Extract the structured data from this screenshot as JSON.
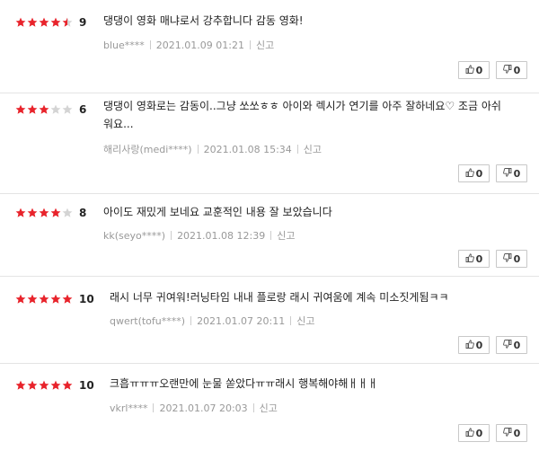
{
  "reviews": [
    {
      "stars": 4.5,
      "score": "9",
      "text": "댕댕이 영화 매냐로서 강추합니다 감동 영화!",
      "author": "blue****",
      "date": "2021.01.09 01:21",
      "report": "신고",
      "likes": "0",
      "dislikes": "0"
    },
    {
      "stars": 3,
      "score": "6",
      "text": "댕댕이 영화로는 감동이..그냥 쏘쏘ㅎㅎ 아이와 렉시가 연기를 아주 잘하네요♡ 조금 아쉬워요...",
      "author": "해리사랑(medi****)",
      "date": "2021.01.08 15:34",
      "report": "신고",
      "likes": "0",
      "dislikes": "0"
    },
    {
      "stars": 4,
      "score": "8",
      "text": "아이도 재밌게 보네요 교훈적인 내용 잘 보았습니다",
      "author": "kk(seyo****)",
      "date": "2021.01.08 12:39",
      "report": "신고",
      "likes": "0",
      "dislikes": "0"
    },
    {
      "stars": 5,
      "score": "10",
      "text": "래시 너무 귀여워!러닝타임 내내 플로랑 래시 귀여움에 계속 미소짓게됨ㅋㅋ",
      "author": "qwert(tofu****)",
      "date": "2021.01.07 20:11",
      "report": "신고",
      "likes": "0",
      "dislikes": "0"
    },
    {
      "stars": 5,
      "score": "10",
      "text": "크흡ㅠㅠㅠ오랜만에 눈물 쏟았다ㅠㅠ래시 행복해야해ㅐㅐㅐ",
      "author": "vkrl****",
      "date": "2021.01.07 20:03",
      "report": "신고",
      "likes": "0",
      "dislikes": "0"
    }
  ],
  "colors": {
    "star_on": "#e8232b",
    "star_off": "#d4d4d4"
  },
  "icons": {
    "like": "thumbs-up-icon",
    "dislike": "thumbs-down-icon"
  }
}
